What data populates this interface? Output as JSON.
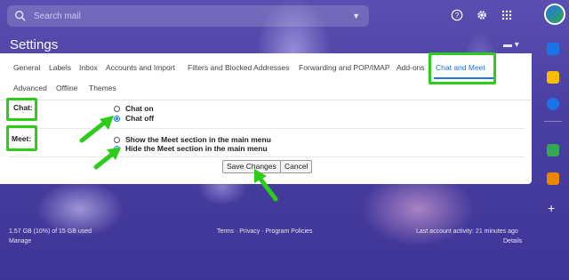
{
  "search": {
    "placeholder": "Search mail"
  },
  "page_title": "Settings",
  "tabs_row1": [
    "General",
    "Labels",
    "Inbox",
    "Accounts and Import",
    "Filters and Blocked Addresses",
    "Forwarding and POP/IMAP",
    "Add-ons",
    "Chat and Meet"
  ],
  "tabs_row2": [
    "Advanced",
    "Offline",
    "Themes"
  ],
  "chat": {
    "label": "Chat:",
    "options": [
      "Chat on",
      "Chat off"
    ],
    "selected": "Chat off"
  },
  "meet": {
    "label": "Meet:",
    "options": [
      "Show the Meet section in the main menu",
      "Hide the Meet section in the main menu"
    ],
    "selected": "Hide the Meet section in the main menu"
  },
  "buttons": {
    "save": "Save Changes",
    "cancel": "Cancel"
  },
  "footer": {
    "storage": "1.57 GB (10%) of 15 GB used",
    "manage": "Manage",
    "terms": "Terms",
    "privacy": "Privacy",
    "policies": "Program Policies",
    "activity": "Last account activity: 21 minutes ago",
    "details": "Details"
  },
  "colors": {
    "highlight": "#2ecc1a",
    "accent": "#1a73e8"
  },
  "icons": [
    "search-icon",
    "help-icon",
    "gear-icon",
    "apps-grid-icon",
    "keyboard-icon"
  ]
}
